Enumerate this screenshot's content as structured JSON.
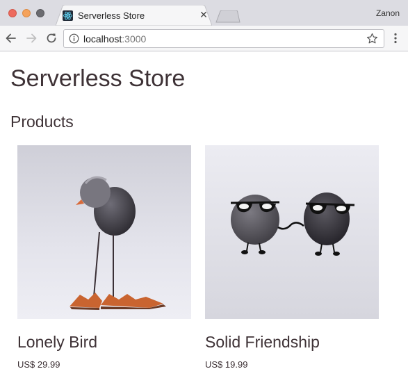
{
  "browser": {
    "tab_title": "Serverless Store",
    "profile_name": "Zanon",
    "url_host": "localhost",
    "url_port": ":3000",
    "accent_colors": {
      "traffic_close": "#ed6a5e",
      "traffic_minimize": "#f5a25b",
      "traffic_maximize": "#6b6b70"
    }
  },
  "page": {
    "title": "Serverless Store",
    "section_title": "Products",
    "text_color": "#3e3236",
    "products": [
      {
        "name": "Lonely Bird",
        "price": "US$ 29.99",
        "image": "bird-figurine-photo"
      },
      {
        "name": "Solid Friendship",
        "price": "US$ 19.99",
        "image": "two-stones-with-sunglasses-photo"
      }
    ]
  }
}
